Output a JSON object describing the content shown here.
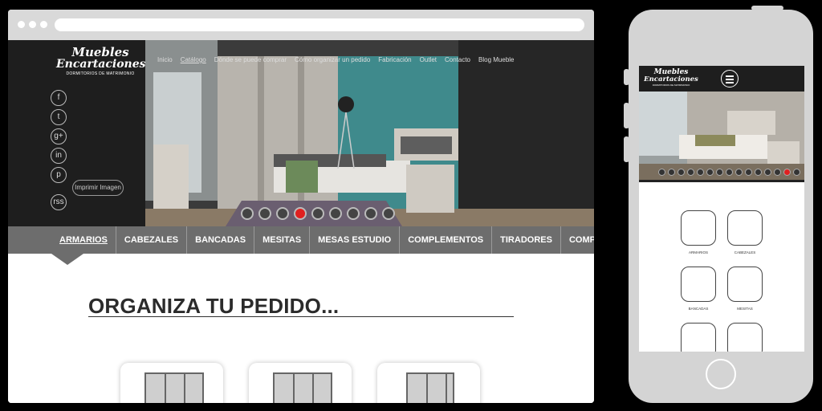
{
  "brand": {
    "name_line1": "Muebles",
    "name_line2": "Encartaciones",
    "tagline": "DORMITORIOS DE MATRIMONIO"
  },
  "nav": {
    "items": [
      "Inicio",
      "Catálogo",
      "Dónde se puede comprar",
      "Cómo organizar un pedido",
      "Fabricación",
      "Outlet",
      "Contacto",
      "Blog Mueble"
    ],
    "active_index": 1
  },
  "social": [
    "f",
    "t",
    "g+",
    "in",
    "p",
    "rss"
  ],
  "print_button": "Imprimir Imagen",
  "categories": {
    "items": [
      "ARMARIOS",
      "CABEZALES",
      "BANCADAS",
      "MESITAS",
      "MESAS ESTUDIO",
      "COMPLEMENTOS",
      "TIRADORES",
      "COMPOSICIONES"
    ],
    "active_index": 0
  },
  "heading": "ORGANIZA TU PEDIDO...",
  "carousel": {
    "count": 9,
    "active_index": 3
  },
  "mobile": {
    "carousel": {
      "count": 15,
      "active_index": 13
    },
    "category_labels": [
      "ARMARIOS",
      "CABEZALES",
      "BANCADAS",
      "MESITAS"
    ]
  },
  "colors": {
    "accent": "#e02020",
    "category_bar": "#6d6d6d",
    "header_dark": "#1e1e1e"
  }
}
